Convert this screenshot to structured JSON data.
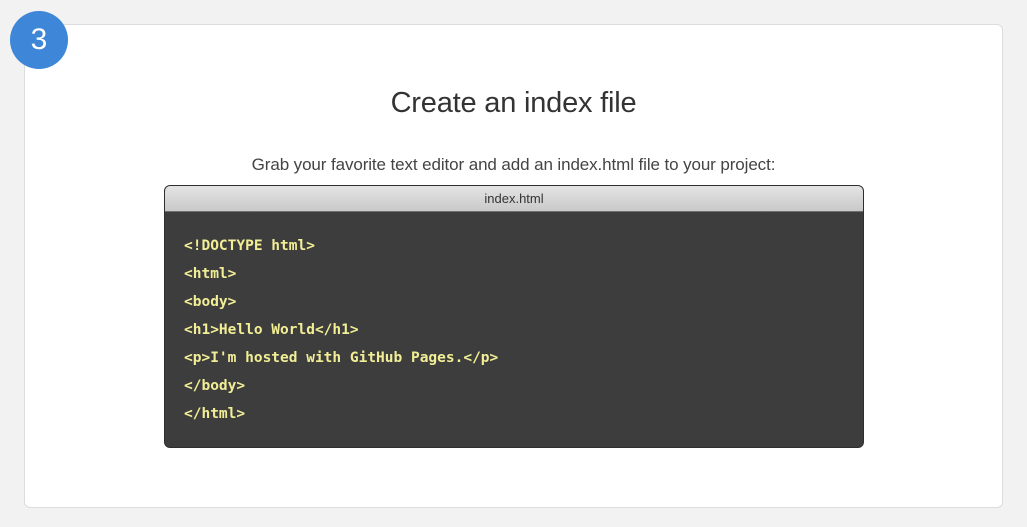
{
  "step": {
    "number": "3"
  },
  "section": {
    "title": "Create an index file",
    "subtitle": "Grab your favorite text editor and add an index.html file to your project:"
  },
  "editor": {
    "filename": "index.html",
    "code_lines": [
      "<!DOCTYPE html>",
      "<html>",
      "<body>",
      "<h1>Hello World</h1>",
      "<p>I'm hosted with GitHub Pages.</p>",
      "</body>",
      "</html>"
    ]
  },
  "colors": {
    "badge": "#3d86d8",
    "code_background": "#3d3d3d",
    "code_text": "#f2ee96"
  }
}
